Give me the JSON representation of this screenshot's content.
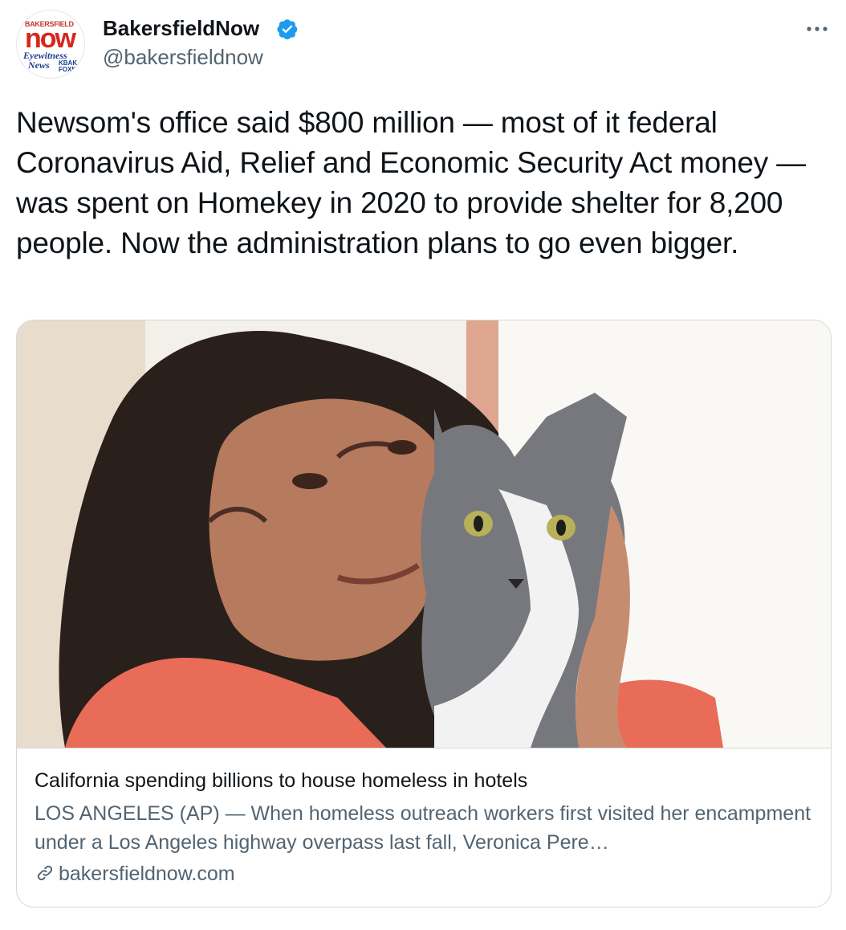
{
  "account": {
    "display_name": "BakersfieldNow",
    "handle": "@bakersfieldnow",
    "verified": true,
    "avatar": {
      "line1": "BAKERSFIELD",
      "line2": "now",
      "line3": "Eyewitness",
      "line4": "News",
      "line5": "KBAK FOX58"
    }
  },
  "tweet": {
    "text": "Newsom's office said $800 million — most of it federal Coronavirus Aid, Relief and Economic Security Act money — was spent on Homekey in 2020 to provide shelter for 8,200 people. Now the administration plans to go even bigger."
  },
  "card": {
    "title": "California spending billions to house homeless in hotels",
    "description": "LOS ANGELES (AP) — When homeless outreach workers first visited her encampment under a Los Angeles highway overpass last fall, Veronica Pere…",
    "domain": "bakersfieldnow.com"
  },
  "icons": {
    "verified": "verified-badge-icon",
    "more": "more-options-icon",
    "link": "link-icon"
  },
  "colors": {
    "verified_blue": "#1d9bf0",
    "secondary_text": "#536471",
    "border": "#cfd9de"
  }
}
